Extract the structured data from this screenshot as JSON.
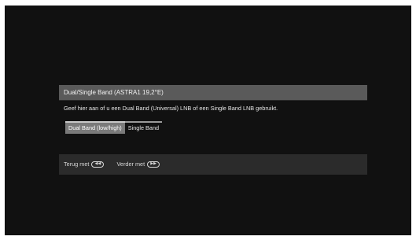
{
  "dialog": {
    "title": "Dual/Single Band (ASTRA1 19,2°E)",
    "message": "Geef hier aan of u een Dual Band (Universal) LNB of een Single Band LNB gebruikt.",
    "options": [
      {
        "label": "Dual Band (low/high)",
        "selected": true
      },
      {
        "label": "Single Band",
        "selected": false
      }
    ],
    "footer": {
      "back_label": "Terug met",
      "back_icon": "rewind-key-icon",
      "forward_label": "Verder met",
      "forward_icon": "fast-forward-key-icon"
    }
  }
}
